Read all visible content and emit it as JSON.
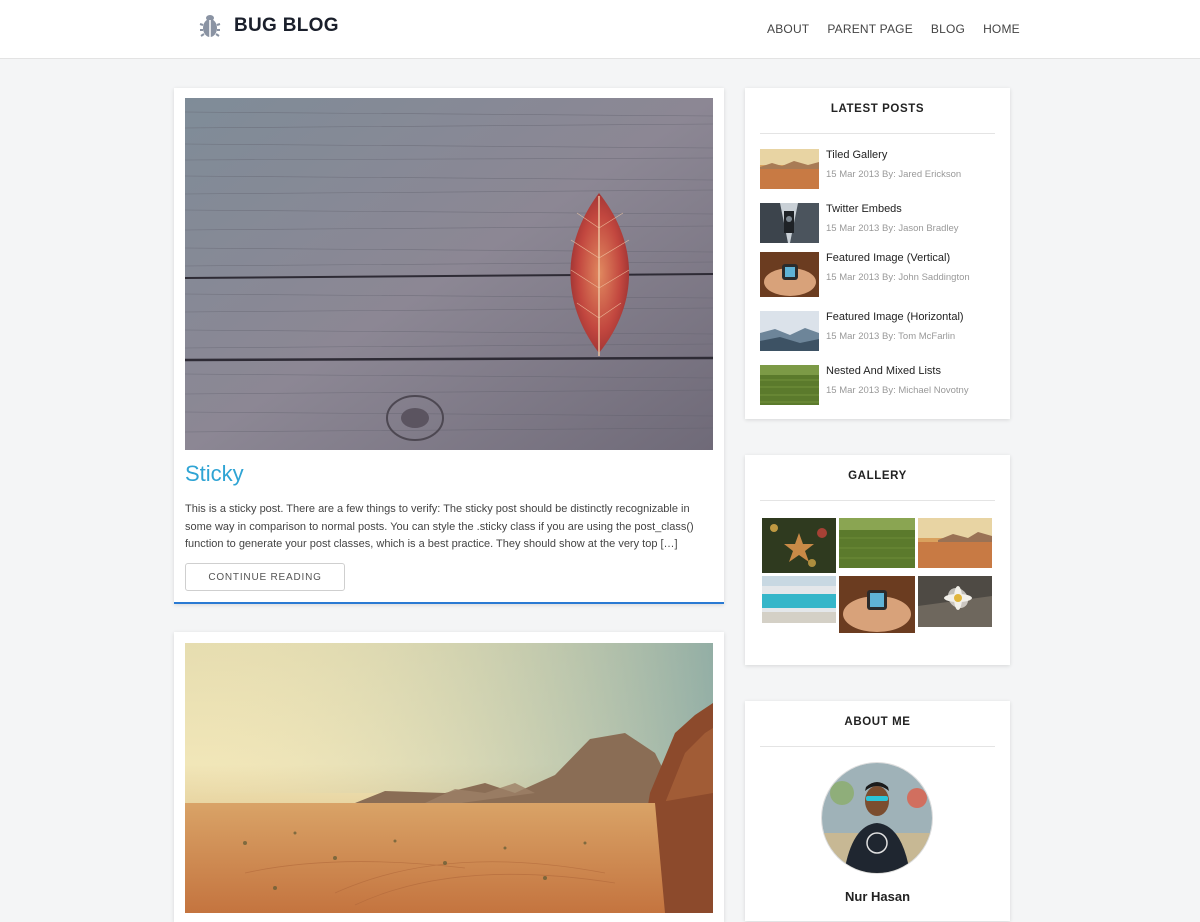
{
  "header": {
    "brand": "BUG BLOG",
    "brand_icon": "bug-icon",
    "nav": [
      "ABOUT",
      "PARENT PAGE",
      "BLOG",
      "HOME"
    ]
  },
  "posts": [
    {
      "title": "Sticky",
      "excerpt": "This is a sticky post. There are a few things to verify: The sticky post should be distinctly recognizable in some way in comparison to normal posts. You can style the .sticky class if you are using the post_class() function to generate your post classes, which is a best practice. They should show at the very top […]",
      "button": "CONTINUE READING"
    }
  ],
  "sidebar": {
    "latest": {
      "title": "LATEST POSTS",
      "items": [
        {
          "title": "Tiled Gallery",
          "meta": "15 Mar 2013 By: Jared Erickson"
        },
        {
          "title": "Twitter Embeds",
          "meta": "15 Mar 2013 By: Jason Bradley"
        },
        {
          "title": "Featured Image (Vertical)",
          "meta": "15 Mar 2013 By: John Saddington"
        },
        {
          "title": "Featured Image (Horizontal)",
          "meta": "15 Mar 2013 By: Tom McFarlin"
        },
        {
          "title": "Nested And Mixed Lists",
          "meta": "15 Mar 2013 By: Michael Novotny"
        }
      ]
    },
    "gallery": {
      "title": "GALLERY"
    },
    "about": {
      "title": "ABOUT ME",
      "name": "Nur Hasan"
    }
  },
  "colors": {
    "accent": "#2fa4d4",
    "sticky_border": "#2a7ad3"
  }
}
